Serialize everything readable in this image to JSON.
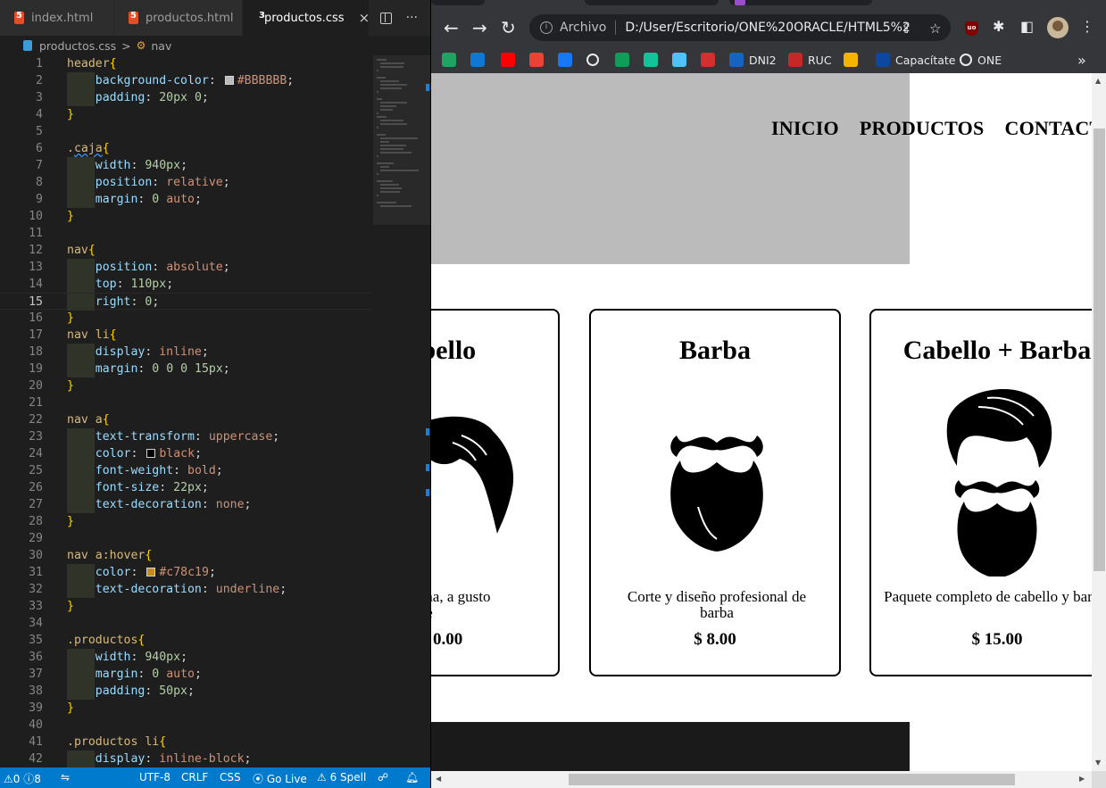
{
  "vscode": {
    "tabs": [
      {
        "label": "index.html",
        "type": "html"
      },
      {
        "label": "productos.html",
        "type": "html"
      },
      {
        "label": "productos.css",
        "type": "css",
        "active": true
      }
    ],
    "close_glyph": "×",
    "more_glyph": "···",
    "breadcrumb": {
      "file": "productos.css",
      "separator": ">",
      "symbol": "nav"
    },
    "current_line": 15,
    "status": {
      "warnings": "0",
      "errors": "8",
      "encoding": "UTF-8",
      "eol": "CRLF",
      "language": "CSS",
      "go_live": "Go Live",
      "spell": "6 Spell"
    }
  },
  "browser": {
    "omnibox": {
      "scheme_label": "Archivo",
      "url": "D:/User/Escritorio/ONE%20ORACLE/HTML5%20..."
    },
    "bookmarks": [
      {
        "label": "",
        "icon": "drive",
        "color": "#1fa463"
      },
      {
        "label": "",
        "icon": "onedrive",
        "color": "#0f78d4"
      },
      {
        "label": "",
        "icon": "youtube",
        "color": "#ff0000"
      },
      {
        "label": "",
        "icon": "gmail",
        "color": "#ea4335"
      },
      {
        "label": "",
        "icon": "facebook",
        "color": "#1877f2"
      },
      {
        "label": "",
        "icon": "globe",
        "color": "#e8eaed"
      },
      {
        "label": "",
        "icon": "hangouts",
        "color": "#0f9d58"
      },
      {
        "label": "",
        "icon": "grammarly",
        "color": "#15c39a"
      },
      {
        "label": "",
        "icon": "mountain",
        "color": "#4fc3f7"
      },
      {
        "label": "",
        "icon": "red-app",
        "color": "#d32f2f"
      },
      {
        "label": "DNI2",
        "icon": "dni",
        "color": "#1565c0"
      },
      {
        "label": "RUC",
        "icon": "ruc",
        "color": "#c62828"
      },
      {
        "label": "",
        "icon": "pencil",
        "color": "#f4b400"
      },
      {
        "label": "Capacítate",
        "icon": "capacitate",
        "color": "#0d47a1"
      },
      {
        "label": "ONE",
        "icon": "alura",
        "color": "#e8eaed"
      }
    ],
    "more_bookmarks": "»",
    "site": {
      "nav": [
        "Inicio",
        "Productos",
        "Contacto"
      ],
      "products": [
        {
          "title": "Cabello",
          "visible_title": "bello",
          "desc": "Corte con máquina, a gusto del cliente",
          "desc_visible": "áquina, a gusto\nliente",
          "price_visible": "0.00"
        },
        {
          "title": "Barba",
          "desc": "Corte y diseño profesional de barba",
          "price": "$ 8.00"
        },
        {
          "title": "Cabello + Barba",
          "desc": "Paquete completo de cabello y barba",
          "price": "$ 15.00"
        }
      ]
    }
  }
}
